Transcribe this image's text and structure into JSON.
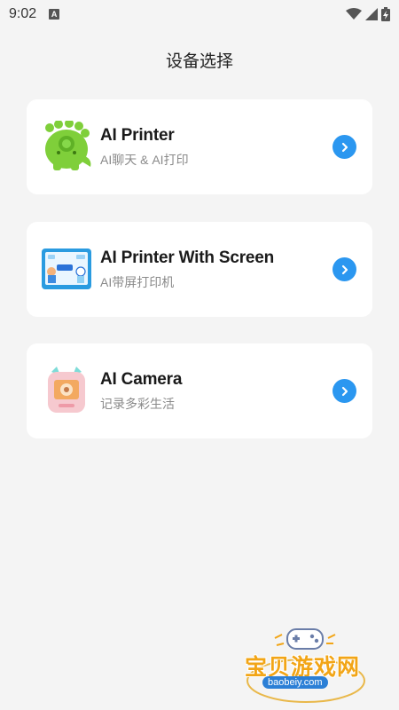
{
  "status_bar": {
    "time": "9:02",
    "notification_letter": "A",
    "icons": [
      "wifi-icon",
      "signal-icon",
      "battery-charging-icon"
    ]
  },
  "page": {
    "title": "设备选择"
  },
  "devices": [
    {
      "title": "AI Printer",
      "subtitle": "AI聊天 & AI打印",
      "image": "green-dino-printer-image",
      "action_icon": "chevron-right-icon"
    },
    {
      "title": "AI Printer With Screen",
      "subtitle": "AI带屏打印机",
      "image": "blue-screen-printer-image",
      "action_icon": "chevron-right-icon"
    },
    {
      "title": "AI Camera",
      "subtitle": "记录多彩生活",
      "image": "pink-cat-camera-image",
      "action_icon": "chevron-right-icon"
    }
  ],
  "watermark": {
    "text": "宝贝游戏网",
    "url": "baobeiy.com"
  },
  "colors": {
    "background": "#f4f4f4",
    "card": "#ffffff",
    "accent": "#2b97f0",
    "subtitle": "#8a8a8a"
  }
}
